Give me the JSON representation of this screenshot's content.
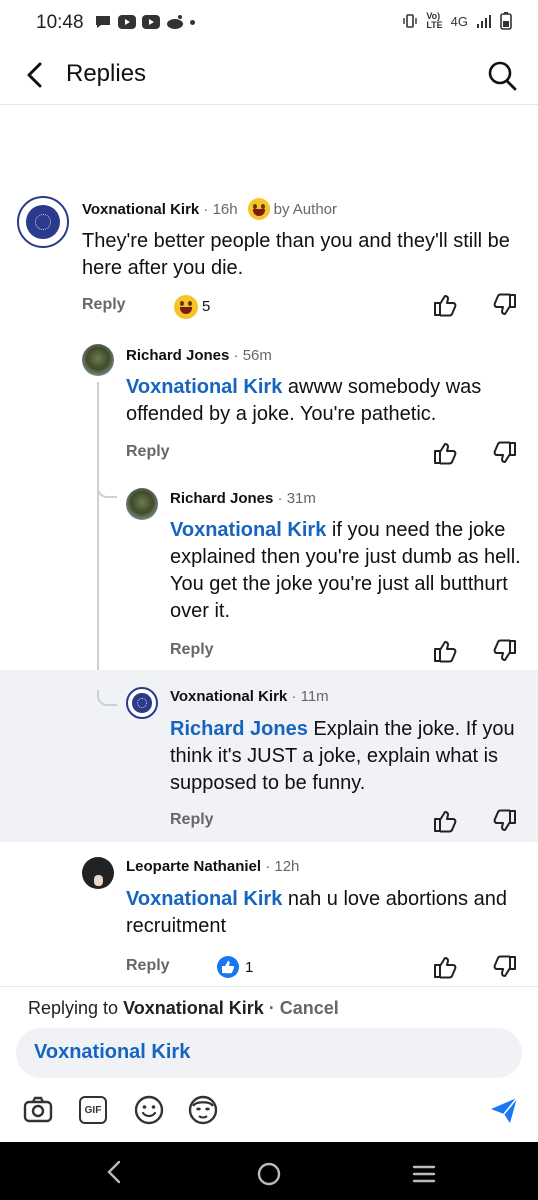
{
  "status": {
    "time": "10:48",
    "network": "4G"
  },
  "header": {
    "title": "Replies"
  },
  "comments": [
    {
      "author": "Voxnational Kirk",
      "time": "16h",
      "badge": "by Author",
      "text": "They're better people than you and they'll still be here after you die.",
      "reply_label": "Reply",
      "reaction_count": "5"
    },
    {
      "author": "Richard Jones",
      "time": "56m",
      "mention": "Voxnational Kirk",
      "text": " awww somebody was offended by a joke. You're pathetic.",
      "reply_label": "Reply"
    },
    {
      "author": "Richard Jones",
      "time": "31m",
      "mention": "Voxnational Kirk",
      "text": " if you need the joke explained then you're just dumb as hell. You get the joke you're just all butthurt over it.",
      "reply_label": "Reply"
    },
    {
      "author": "Voxnational Kirk",
      "time": "11m",
      "mention": "Richard Jones",
      "text": " Explain the joke. If you think it's JUST a joke, explain what is supposed to be funny.",
      "reply_label": "Reply"
    },
    {
      "author": "Leoparte Nathaniel",
      "time": "12h",
      "mention": "Voxnational Kirk",
      "text": " nah u love abortions and recruitment",
      "reply_label": "Reply",
      "reaction_count": "1"
    }
  ],
  "composer": {
    "replying_prefix": "Replying to ",
    "replying_to": "Voxnational Kirk",
    "separator": " · ",
    "cancel": "Cancel",
    "input_value": "Voxnational Kirk",
    "gif_label": "GIF"
  },
  "colors": {
    "mention": "#1565c0",
    "highlight_bg": "#f0f2f5",
    "like_blue": "#1877f2"
  }
}
